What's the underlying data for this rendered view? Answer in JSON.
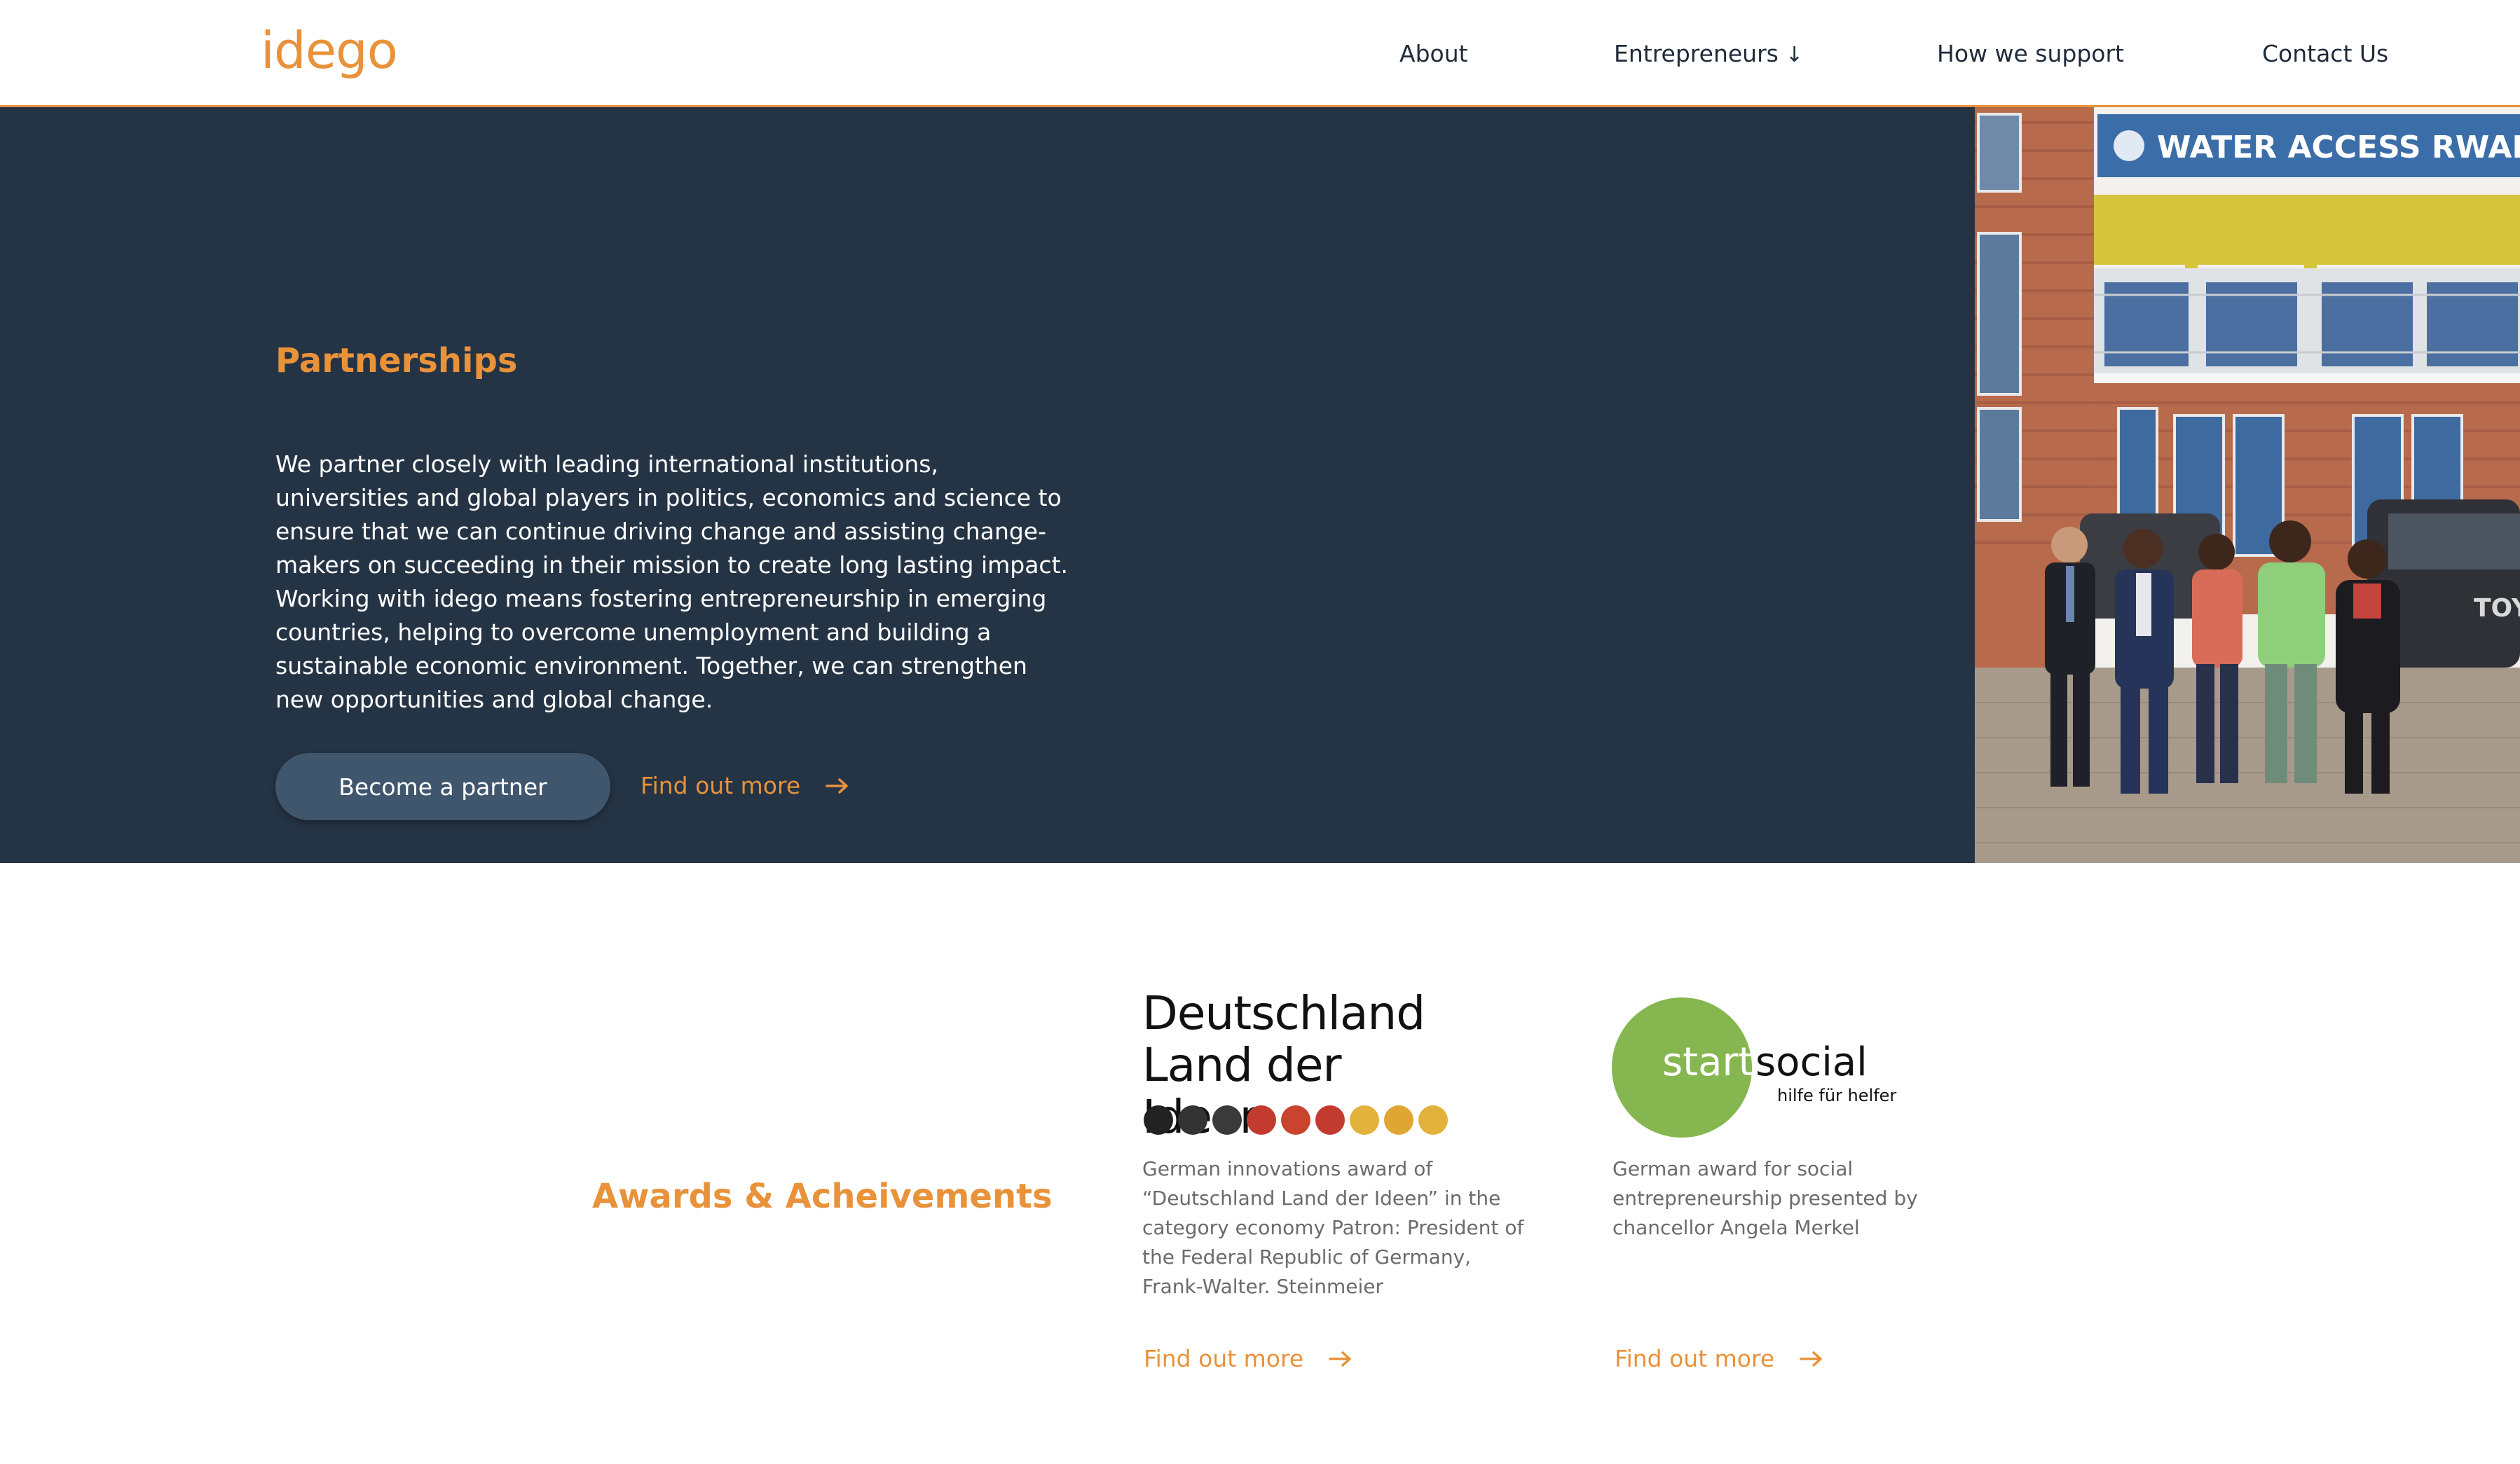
{
  "header": {
    "logo": "idego",
    "nav": [
      {
        "label": "About"
      },
      {
        "label": "Entrepreneurs"
      },
      {
        "label": "How we support"
      },
      {
        "label": "Contact Us"
      }
    ],
    "nav_dropdown_icon": "arrow-down-icon"
  },
  "partnerships": {
    "title": "Partnerships",
    "body": "We partner closely with leading international institutions, universities and global players in politics, economics and science to ensure that we can continue driving change and assisting change-makers on succeeding in their mission to create long lasting impact. Working with idego means fostering entrepreneurship in emerging countries, helping to overcome unemployment and building a sustainable economic environment. Together, we can strengthen new opportunities and global change.",
    "cta_label": "Become a partner",
    "more_label": "Find out more",
    "photo_sign": "WATER ACCESS RWANDA",
    "photo_car_text": "TOY"
  },
  "awards": {
    "title": "Awards & Acheivements",
    "items": [
      {
        "logo_line1": "Deutschland",
        "logo_line2": "Land der Ideen",
        "description": "German innovations award of “Deutschland Land der Ideen” in the category economy Patron: President of the Federal Republic of Germany, Frank-Walter. Steinmeier",
        "more_label": "Find out more"
      },
      {
        "logo_start": "start",
        "logo_social": "social",
        "logo_sub": "hilfe für helfer",
        "description": "German award for social entrepreneurship presented by chancellor Angela Merkel",
        "more_label": "Find out more"
      }
    ]
  },
  "colors": {
    "accent": "#e8923a",
    "hero_bg": "#253445",
    "button_bg": "#3f566d",
    "startsocial_green": "#86b650"
  }
}
